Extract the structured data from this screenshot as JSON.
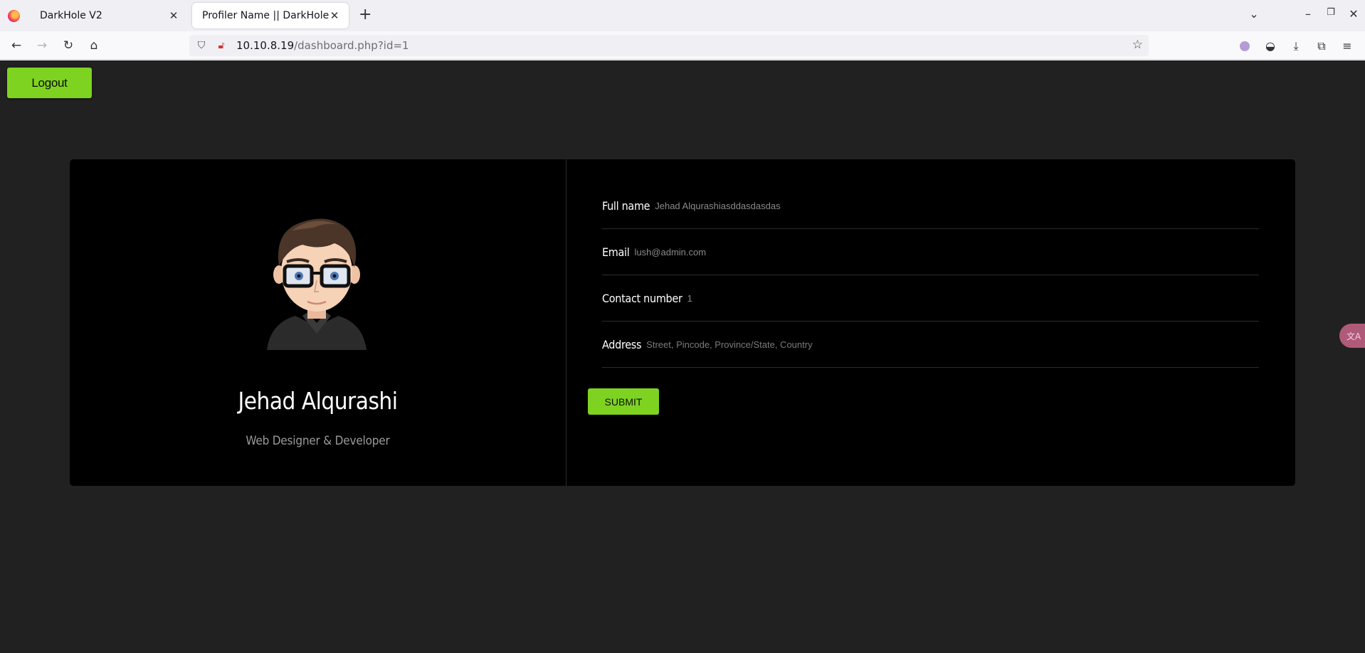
{
  "browser": {
    "tabs": [
      {
        "title": "DarkHole V2",
        "active": false
      },
      {
        "title": "Profiler Name || DarkHole",
        "active": true
      }
    ],
    "url": {
      "host": "10.10.8.19",
      "path": "/dashboard.php?id=1"
    }
  },
  "page": {
    "logout_label": "Logout",
    "profile": {
      "name": "Jehad Alqurashi",
      "role": "Web Designer & Developer"
    },
    "form": {
      "fields": [
        {
          "label": "Full name",
          "value": "Jehad Alqurashiasddasdasdas",
          "placeholder": ""
        },
        {
          "label": "Email",
          "value": "lush@admin.com",
          "placeholder": ""
        },
        {
          "label": "Contact number",
          "value": "1",
          "placeholder": ""
        },
        {
          "label": "Address",
          "value": "",
          "placeholder": "Street, Pincode, Province/State, Country"
        }
      ],
      "submit_label": "SUBMIT"
    },
    "colors": {
      "accent": "#7ed321",
      "background": "#212121",
      "card": "#000000"
    }
  }
}
